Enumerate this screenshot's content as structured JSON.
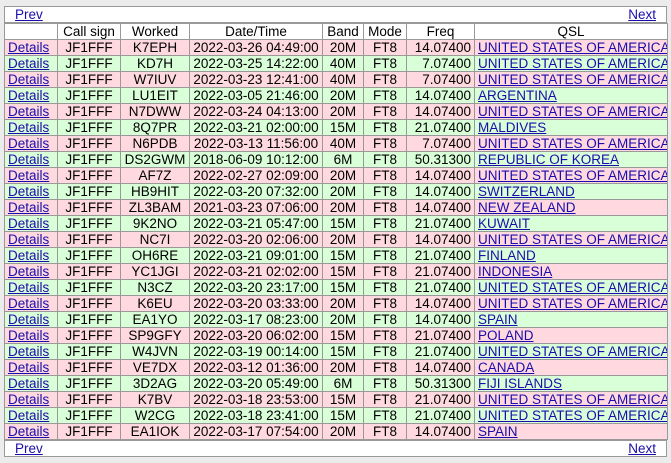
{
  "nav": {
    "prev_label": "Prev",
    "next_label": "Next"
  },
  "columns": [
    "",
    "Call sign",
    "Worked",
    "Date/Time",
    "Band",
    "Mode",
    "Freq",
    "QSL"
  ],
  "colors": {
    "pink_row": "#ffd9df",
    "green_row": "#d9ffd9",
    "link": "#1a0dab"
  },
  "details_label": "Details",
  "rows": [
    {
      "call": "JF1FFF",
      "worked": "K7EPH",
      "dt": "2022-03-26 04:49:00",
      "band": "20M",
      "mode": "FT8",
      "freq": "14.07400",
      "qsl": "UNITED STATES OF AMERICA",
      "color": "pink"
    },
    {
      "call": "JF1FFF",
      "worked": "KD7H",
      "dt": "2022-03-25 14:22:00",
      "band": "40M",
      "mode": "FT8",
      "freq": "7.07400",
      "qsl": "UNITED STATES OF AMERICA",
      "color": "green"
    },
    {
      "call": "JF1FFF",
      "worked": "W7IUV",
      "dt": "2022-03-23 12:41:00",
      "band": "40M",
      "mode": "FT8",
      "freq": "7.07400",
      "qsl": "UNITED STATES OF AMERICA",
      "color": "pink"
    },
    {
      "call": "JF1FFF",
      "worked": "LU1EIT",
      "dt": "2022-03-05 21:46:00",
      "band": "20M",
      "mode": "FT8",
      "freq": "14.07400",
      "qsl": "ARGENTINA",
      "color": "green"
    },
    {
      "call": "JF1FFF",
      "worked": "N7DWW",
      "dt": "2022-03-24 04:13:00",
      "band": "20M",
      "mode": "FT8",
      "freq": "14.07400",
      "qsl": "UNITED STATES OF AMERICA",
      "color": "pink"
    },
    {
      "call": "JF1FFF",
      "worked": "8Q7PR",
      "dt": "2022-03-21 02:00:00",
      "band": "15M",
      "mode": "FT8",
      "freq": "21.07400",
      "qsl": "MALDIVES",
      "color": "green"
    },
    {
      "call": "JF1FFF",
      "worked": "N6PDB",
      "dt": "2022-03-13 11:56:00",
      "band": "40M",
      "mode": "FT8",
      "freq": "7.07400",
      "qsl": "UNITED STATES OF AMERICA",
      "color": "pink"
    },
    {
      "call": "JF1FFF",
      "worked": "DS2GWM",
      "dt": "2018-06-09 10:12:00",
      "band": "6M",
      "mode": "FT8",
      "freq": "50.31300",
      "qsl": "REPUBLIC OF KOREA",
      "color": "green"
    },
    {
      "call": "JF1FFF",
      "worked": "AF7Z",
      "dt": "2022-02-27 02:09:00",
      "band": "20M",
      "mode": "FT8",
      "freq": "14.07400",
      "qsl": "UNITED STATES OF AMERICA",
      "color": "pink"
    },
    {
      "call": "JF1FFF",
      "worked": "HB9HIT",
      "dt": "2022-03-20 07:32:00",
      "band": "20M",
      "mode": "FT8",
      "freq": "14.07400",
      "qsl": "SWITZERLAND",
      "color": "green"
    },
    {
      "call": "JF1FFF",
      "worked": "ZL3BAM",
      "dt": "2021-03-23 07:06:00",
      "band": "20M",
      "mode": "FT8",
      "freq": "14.07400",
      "qsl": "NEW ZEALAND",
      "color": "pink"
    },
    {
      "call": "JF1FFF",
      "worked": "9K2NO",
      "dt": "2022-03-21 05:47:00",
      "band": "15M",
      "mode": "FT8",
      "freq": "21.07400",
      "qsl": "KUWAIT",
      "color": "green"
    },
    {
      "call": "JF1FFF",
      "worked": "NC7I",
      "dt": "2022-03-20 02:06:00",
      "band": "20M",
      "mode": "FT8",
      "freq": "14.07400",
      "qsl": "UNITED STATES OF AMERICA",
      "color": "pink"
    },
    {
      "call": "JF1FFF",
      "worked": "OH6RE",
      "dt": "2022-03-21 09:01:00",
      "band": "15M",
      "mode": "FT8",
      "freq": "21.07400",
      "qsl": "FINLAND",
      "color": "green"
    },
    {
      "call": "JF1FFF",
      "worked": "YC1JGI",
      "dt": "2022-03-21 02:02:00",
      "band": "15M",
      "mode": "FT8",
      "freq": "21.07400",
      "qsl": "INDONESIA",
      "color": "pink"
    },
    {
      "call": "JF1FFF",
      "worked": "N3CZ",
      "dt": "2022-03-20 23:17:00",
      "band": "15M",
      "mode": "FT8",
      "freq": "21.07400",
      "qsl": "UNITED STATES OF AMERICA",
      "color": "green"
    },
    {
      "call": "JF1FFF",
      "worked": "K6EU",
      "dt": "2022-03-20 03:33:00",
      "band": "20M",
      "mode": "FT8",
      "freq": "14.07400",
      "qsl": "UNITED STATES OF AMERICA",
      "color": "pink"
    },
    {
      "call": "JF1FFF",
      "worked": "EA1YO",
      "dt": "2022-03-17 08:23:00",
      "band": "20M",
      "mode": "FT8",
      "freq": "14.07400",
      "qsl": "SPAIN",
      "color": "green"
    },
    {
      "call": "JF1FFF",
      "worked": "SP9GFY",
      "dt": "2022-03-20 06:02:00",
      "band": "15M",
      "mode": "FT8",
      "freq": "21.07400",
      "qsl": "POLAND",
      "color": "pink"
    },
    {
      "call": "JF1FFF",
      "worked": "W4JVN",
      "dt": "2022-03-19 00:14:00",
      "band": "15M",
      "mode": "FT8",
      "freq": "21.07400",
      "qsl": "UNITED STATES OF AMERICA",
      "color": "green"
    },
    {
      "call": "JF1FFF",
      "worked": "VE7DX",
      "dt": "2022-03-12 01:36:00",
      "band": "20M",
      "mode": "FT8",
      "freq": "14.07400",
      "qsl": "CANADA",
      "color": "pink"
    },
    {
      "call": "JF1FFF",
      "worked": "3D2AG",
      "dt": "2022-03-20 05:49:00",
      "band": "6M",
      "mode": "FT8",
      "freq": "50.31300",
      "qsl": "FIJI ISLANDS",
      "color": "green"
    },
    {
      "call": "JF1FFF",
      "worked": "K7BV",
      "dt": "2022-03-18 23:53:00",
      "band": "15M",
      "mode": "FT8",
      "freq": "21.07400",
      "qsl": "UNITED STATES OF AMERICA",
      "color": "pink"
    },
    {
      "call": "JF1FFF",
      "worked": "W2CG",
      "dt": "2022-03-18 23:41:00",
      "band": "15M",
      "mode": "FT8",
      "freq": "21.07400",
      "qsl": "UNITED STATES OF AMERICA",
      "color": "green"
    },
    {
      "call": "JF1FFF",
      "worked": "EA1IOK",
      "dt": "2022-03-17 07:54:00",
      "band": "20M",
      "mode": "FT8",
      "freq": "14.07400",
      "qsl": "SPAIN",
      "color": "pink"
    }
  ]
}
